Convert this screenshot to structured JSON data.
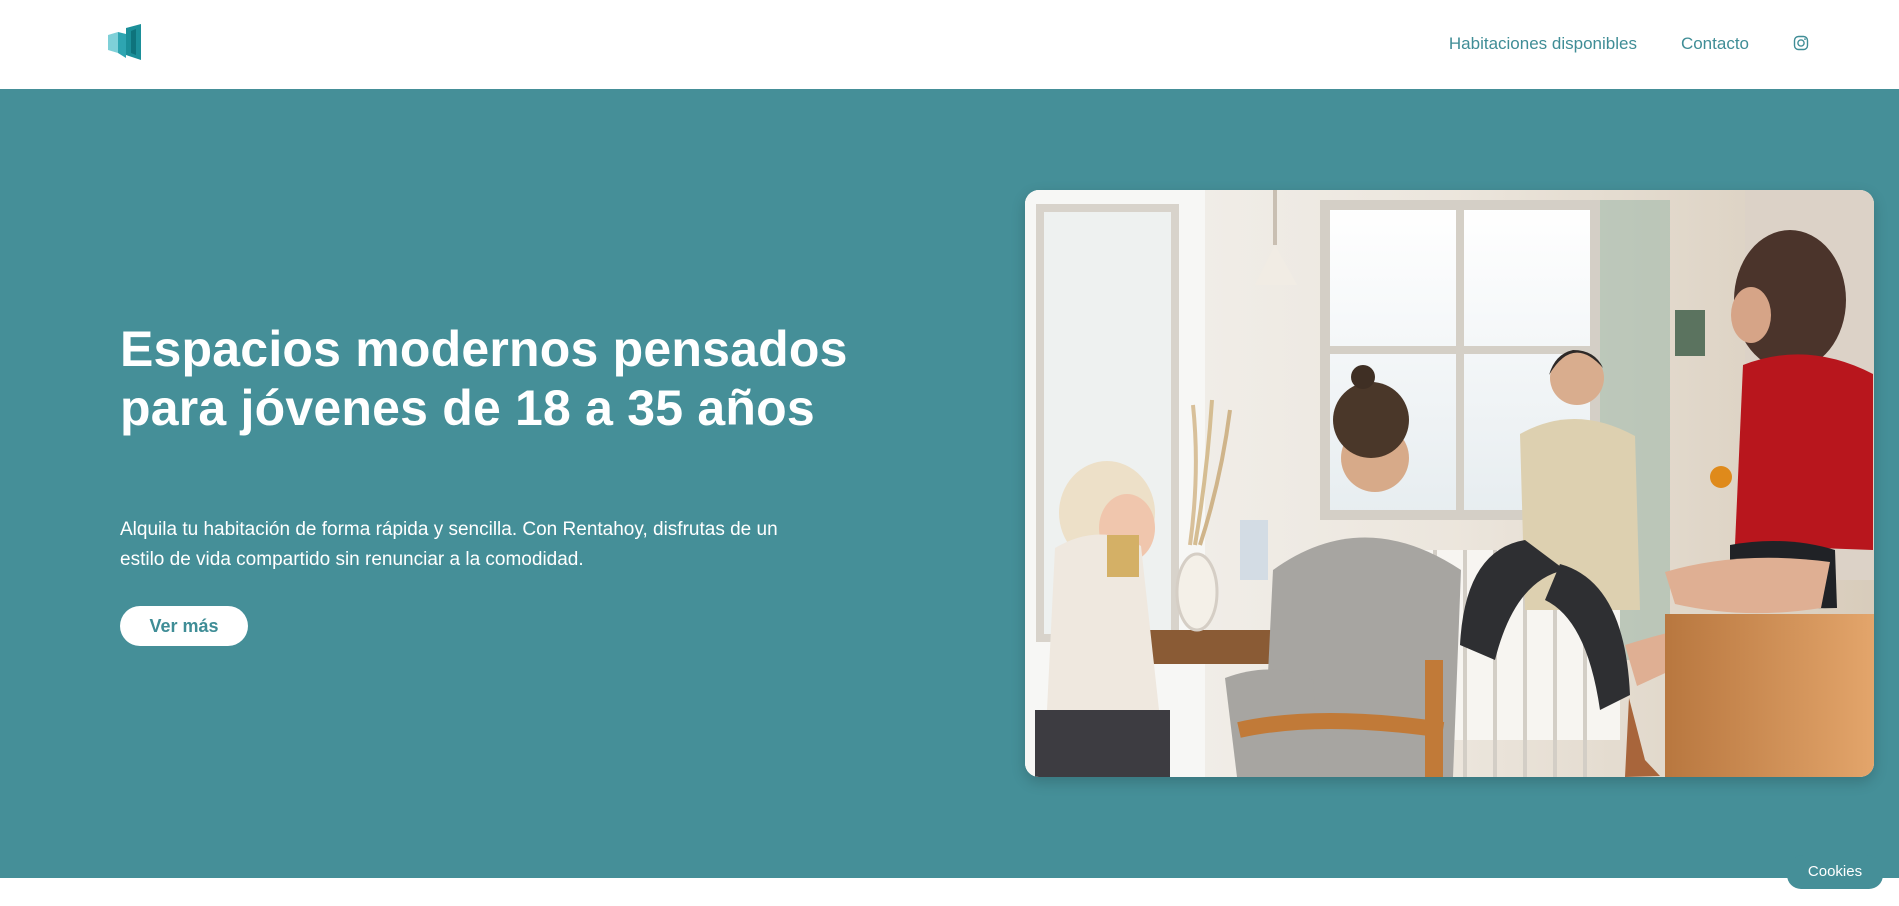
{
  "colors": {
    "brand": "#458f98",
    "brand_dark": "#3f8d96",
    "white": "#ffffff"
  },
  "header": {
    "logo_icon": "building-logo-icon",
    "nav": [
      {
        "label": "Habitaciones disponibles"
      },
      {
        "label": "Contacto"
      }
    ],
    "social_icon": "instagram-icon"
  },
  "hero": {
    "title": "Espacios modernos pensados para jóvenes de 18 a 35 años",
    "description": "Alquila tu habitación de forma rápida y sencilla. Con Rentahoy, disfrutas de un estilo de vida compartido sin renunciar a la comodidad.",
    "cta_label": "Ver más"
  },
  "cookie_button_label": "Cookies"
}
